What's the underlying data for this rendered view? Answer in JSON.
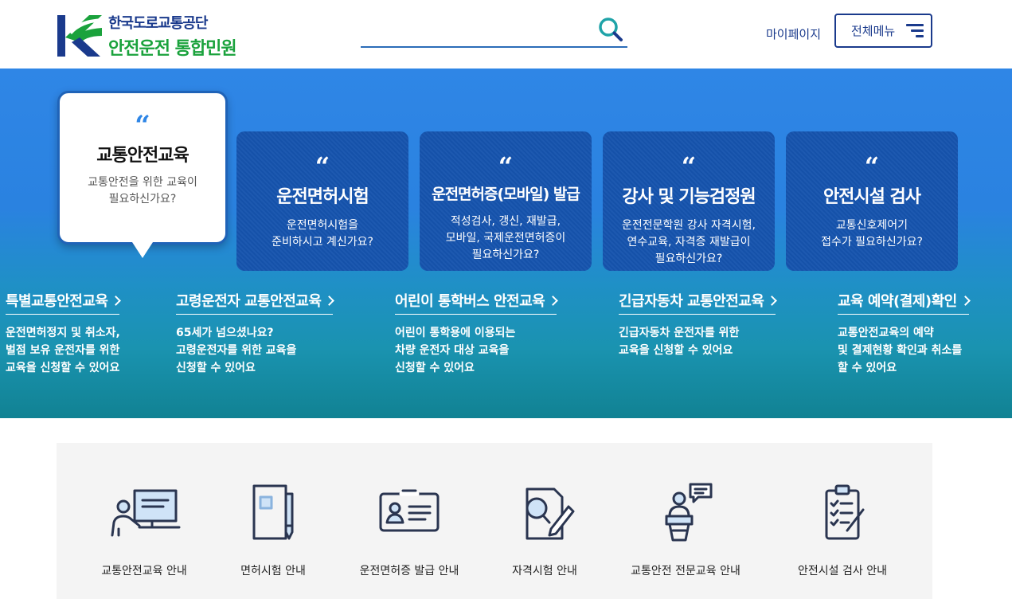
{
  "header": {
    "logo_line1": "한국도로교통공단",
    "logo_line2": "안전운전 통합민원",
    "search_placeholder": "",
    "mypage": "마이페이지",
    "allmenu": "전체메뉴"
  },
  "cards": [
    {
      "quote": "“",
      "title": "교통안전교육",
      "desc1": "교통안전을 위한 교육이",
      "desc2": "필요하신가요?",
      "desc3": ""
    },
    {
      "quote": "“",
      "title": "운전면허시험",
      "desc1": "운전면허시험을",
      "desc2": "준비하시고 계신가요?",
      "desc3": ""
    },
    {
      "quote": "“",
      "title": "운전면허증(모바일) 발급",
      "desc1": "적성검사, 갱신, 재발급,",
      "desc2": "모바일, 국제운전면허증이",
      "desc3": "필요하신가요?"
    },
    {
      "quote": "“",
      "title": "강사 및 기능검정원",
      "desc1": "운전전문학원 강사 자격시험,",
      "desc2": "연수교육, 자격증 재발급이",
      "desc3": "필요하신가요?"
    },
    {
      "quote": "“",
      "title": "안전시설 검사",
      "desc1": "교통신호제어기",
      "desc2": "접수가 필요하신가요?",
      "desc3": ""
    }
  ],
  "links": [
    {
      "title": "특별교통안전교육",
      "d1": "운전면허정지 및 취소자,",
      "d2": "벌점 보유 운전자를 위한",
      "d3": "교육을 신청할 수 있어요"
    },
    {
      "title": "고령운전자 교통안전교육",
      "d1": "65세가 넘으셨나요?",
      "d2": "고령운전자를 위한 교육을",
      "d3": "신청할 수 있어요"
    },
    {
      "title": "어린이 통학버스 안전교육",
      "d1": "어린이 통학용에 이용되는",
      "d2": "차량 운전자 대상 교육을",
      "d3": "신청할 수 있어요"
    },
    {
      "title": "긴급자동차 교통안전교육",
      "d1": "긴급자동차 운전자를 위한",
      "d2": "교육을 신청할 수 있어요",
      "d3": ""
    },
    {
      "title": "교육 예약(결제)확인",
      "d1": "교통안전교육의 예약",
      "d2": "및 결제현황 확인과 취소를",
      "d3": "할 수 있어요"
    }
  ],
  "quick": [
    {
      "label": "교통안전교육 안내",
      "icon": "teacher-board-icon"
    },
    {
      "label": "면허시험 안내",
      "icon": "license-exam-icon"
    },
    {
      "label": "운전면허증 발급 안내",
      "icon": "id-card-icon"
    },
    {
      "label": "자격시험 안내",
      "icon": "certificate-exam-icon"
    },
    {
      "label": "교통안전 전문교육 안내",
      "icon": "lecturer-podium-icon"
    },
    {
      "label": "안전시설 검사 안내",
      "icon": "checklist-clipboard-icon"
    }
  ],
  "colors": {
    "brand_blue": "#1a3a8c",
    "brand_green": "#1aa23c",
    "hero_blue": "#2f86e6",
    "card_blue": "#1654ae"
  }
}
